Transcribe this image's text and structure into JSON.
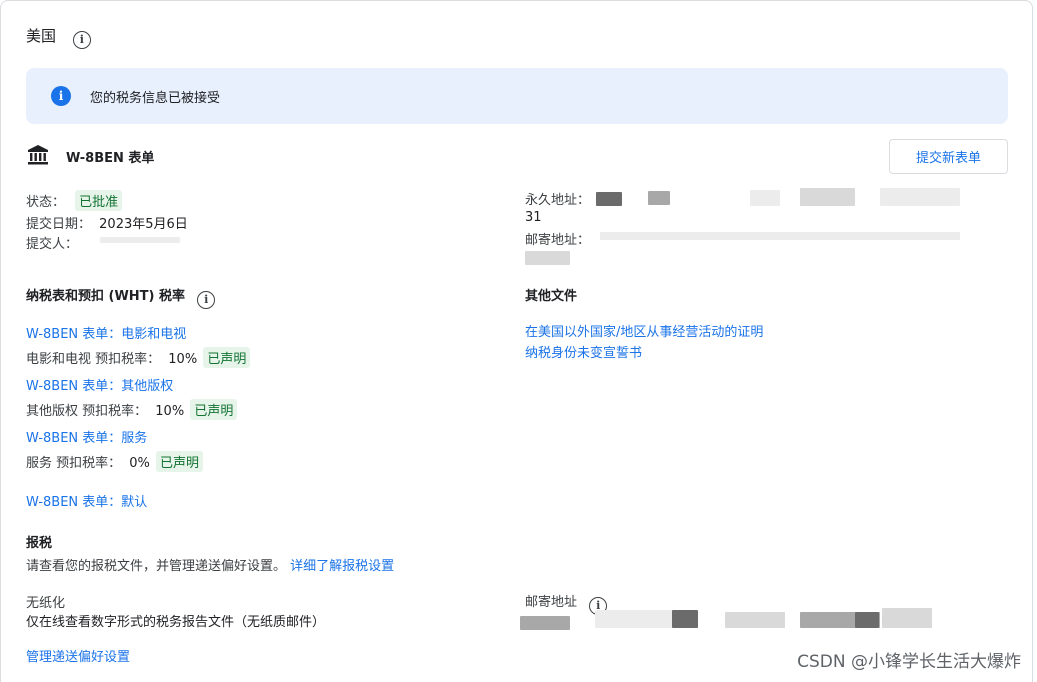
{
  "country": {
    "title": "美国"
  },
  "banner": {
    "text": "您的税务信息已被接受"
  },
  "form": {
    "title": "W-8BEN 表单",
    "submit_button": "提交新表单",
    "status_label": "状态：",
    "status_value": "已批准",
    "date_label": "提交日期：",
    "date_value": "2023年5月6日",
    "submitter_label": "提交人：",
    "permanent_address_label": "永久地址：",
    "permanent_address_partial": "31",
    "mailing_address_label": "邮寄地址："
  },
  "wht": {
    "title": "纳税表和预扣 (WHT) 税率",
    "items": [
      {
        "link": "W-8BEN 表单：电影和电视",
        "rate_label": "电影和电视 预扣税率：",
        "rate": "10%",
        "badge": "已声明"
      },
      {
        "link": "W-8BEN 表单：其他版权",
        "rate_label": "其他版权 预扣税率：",
        "rate": "10%",
        "badge": "已声明"
      },
      {
        "link": "W-8BEN 表单：服务",
        "rate_label": "服务 预扣税率：",
        "rate": "0%",
        "badge": "已声明"
      }
    ],
    "default_link": "W-8BEN 表单：默认"
  },
  "other_files": {
    "title": "其他文件",
    "links": [
      "在美国以外国家/地区从事经营活动的证明",
      "纳税身份未变宣誓书"
    ]
  },
  "tax_reporting": {
    "title": "报税",
    "description": "请查看您的报税文件，并管理递送偏好设置。",
    "description_link": "详细了解报税设置",
    "paperless_label": "无纸化",
    "paperless_value": "仅在线查看数字形式的税务报告文件（无纸质邮件）",
    "mailing_address_label": "邮寄地址",
    "manage_link": "管理递送偏好设置"
  },
  "credit": "CSDN @小锋学长生活大爆炸",
  "colors": {
    "link": "#1a73e8",
    "banner_bg": "#e8f0fe",
    "chip_bg": "#e6f4ea",
    "chip_text": "#137333"
  }
}
